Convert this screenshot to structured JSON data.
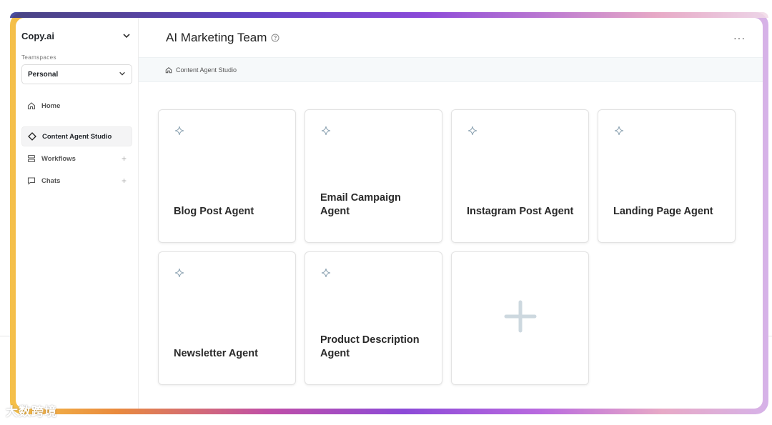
{
  "sidebar": {
    "brand": "Copy.ai",
    "teamspaces_label": "Teamspaces",
    "teamspace_selected": "Personal",
    "items": [
      {
        "label": "Home"
      },
      {
        "label": "Content Agent Studio"
      },
      {
        "label": "Workflows"
      },
      {
        "label": "Chats"
      }
    ]
  },
  "header": {
    "title": "AI Marketing Team",
    "more": "···"
  },
  "breadcrumb": {
    "label": "Content Agent Studio"
  },
  "cards": [
    {
      "label": "Blog Post Agent"
    },
    {
      "label": "Email Campaign Agent"
    },
    {
      "label": "Instagram Post Agent"
    },
    {
      "label": "Landing Page Agent"
    },
    {
      "label": "Newsletter Agent"
    },
    {
      "label": "Product Description Agent"
    }
  ],
  "watermark": "大数跨境",
  "colors": {
    "accent_icon": "#8ea4b3",
    "breadcrumb_bg": "#f6f9fa"
  }
}
